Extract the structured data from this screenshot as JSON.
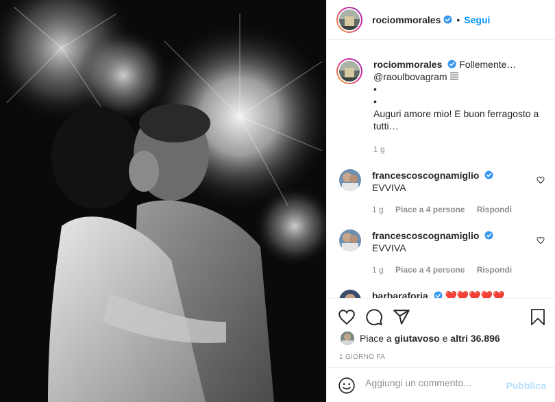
{
  "post": {
    "author": "rociommorales",
    "follow_label": "Segui",
    "separator": "•"
  },
  "caption": {
    "author": "rociommorales",
    "text_intro": "Follemente…",
    "mention": "@raoulbovagram",
    "bullet_1": "•",
    "bullet_2": "•",
    "text_body": "Auguri amore mio! E buon ferragosto a tutti…",
    "age": "1 g"
  },
  "comments": [
    {
      "author": "francescoscognamiglio",
      "text": "EVVIVA",
      "age": "1 g",
      "likes": "Piace a 4 persone",
      "reply": "Rispondi"
    },
    {
      "author": "francescoscognamiglio",
      "text": "EVVIVA",
      "age": "1 g",
      "likes": "Piace a 4 persone",
      "reply": "Rispondi"
    },
    {
      "author": "barbaraforia",
      "text": "❤️❤️❤️❤️❤️"
    }
  ],
  "likes": {
    "prefix": "Piace a",
    "user": "giutavoso",
    "middle": "e",
    "others": "altri 36.896"
  },
  "posted_time": "1 GIORNO FA",
  "add_comment": {
    "placeholder": "Aggiungi un commento...",
    "publish_label": "Pubblica"
  },
  "icons": [
    "verified-badge-icon",
    "heart-icon",
    "comment-icon",
    "share-icon",
    "save-icon",
    "emoji-icon"
  ],
  "colors": {
    "accent": "#0095f6",
    "publish_disabled": "#b2dffc",
    "secondary_text": "#8e8e8e",
    "verified": "#3897f0"
  }
}
